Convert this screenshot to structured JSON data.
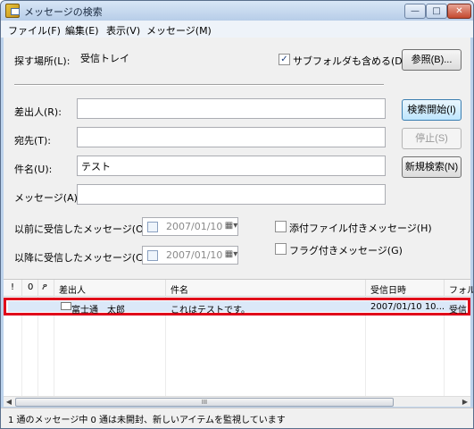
{
  "window": {
    "title": "メッセージの検索",
    "min_glyph": "—",
    "max_glyph": "□",
    "close_glyph": "✕"
  },
  "menu": [
    "ファイル(F)",
    "編集(E)",
    "表示(V)",
    "メッセージ(M)"
  ],
  "search": {
    "location_label": "探す場所(L):",
    "location_value": "受信トレイ",
    "subfolder_label": "サブフォルダも含める(D)",
    "subfolder_checked": true,
    "browse_button": "参照(B)...",
    "from_label": "差出人(R):",
    "from_value": "",
    "to_label": "宛先(T):",
    "to_value": "",
    "subject_label": "件名(U):",
    "subject_value": "テスト",
    "message_label": "メッセージ(A):",
    "message_value": "",
    "before_label": "以前に受信したメッセージ(O):",
    "before_date": "2007/01/10",
    "after_label": "以降に受信したメッセージ(C):",
    "after_date": "2007/01/10",
    "attachment_label": "添付ファイル付きメッセージ(H)",
    "flagged_label": "フラグ付きメッセージ(G)",
    "start_button": "検索開始(I)",
    "stop_button": "停止(S)",
    "new_search_button": "新規検索(N)"
  },
  "results": {
    "columns": [
      "!",
      "0",
      "ዖ",
      "差出人",
      "件名",
      "受信日時",
      "フォル"
    ],
    "rows": [
      {
        "from": "富士通　太郎",
        "subject": "これはテストです。",
        "received": "2007/01/10 10...",
        "folder": "受信"
      }
    ],
    "scroll_grip": "III"
  },
  "status": "1 通のメッセージ中 0 通は未開封、新しいアイテムを監視しています",
  "colors": {
    "highlight_border": "#e0001a",
    "selection": "#dbe8f8"
  }
}
